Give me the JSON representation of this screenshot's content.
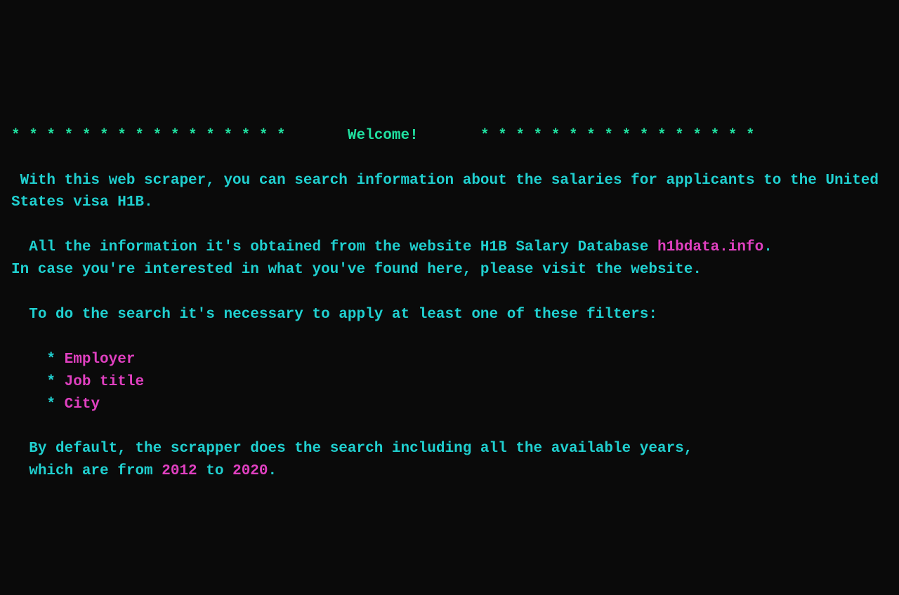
{
  "header": {
    "stars_left": "* * * * * * * * * * * * * * * *",
    "title": "Welcome!",
    "stars_right": "* * * * * * * * * * * * * * * *"
  },
  "intro": " With this web scraper, you can search information about the salaries for applicants to the United States visa H1B.",
  "source_line_prefix": "  All the information it's obtained from the website H1B Salary Database ",
  "source_url": "h1bdata.info",
  "source_line_suffix": ".",
  "visit_line": "In case you're interested in what you've found here, please visit the website.",
  "filters_intro": "  To do the search it's necessary to apply at least one of these filters:",
  "filters": {
    "bullet": "    * ",
    "items": [
      "Employer",
      "Job title",
      "City"
    ]
  },
  "default_line_1": "  By default, the scrapper does the search including all the available years,",
  "default_line_2_prefix": "  which are from ",
  "year_start": "2012",
  "default_line_2_mid": " to ",
  "year_end": "2020",
  "default_line_2_suffix": "."
}
